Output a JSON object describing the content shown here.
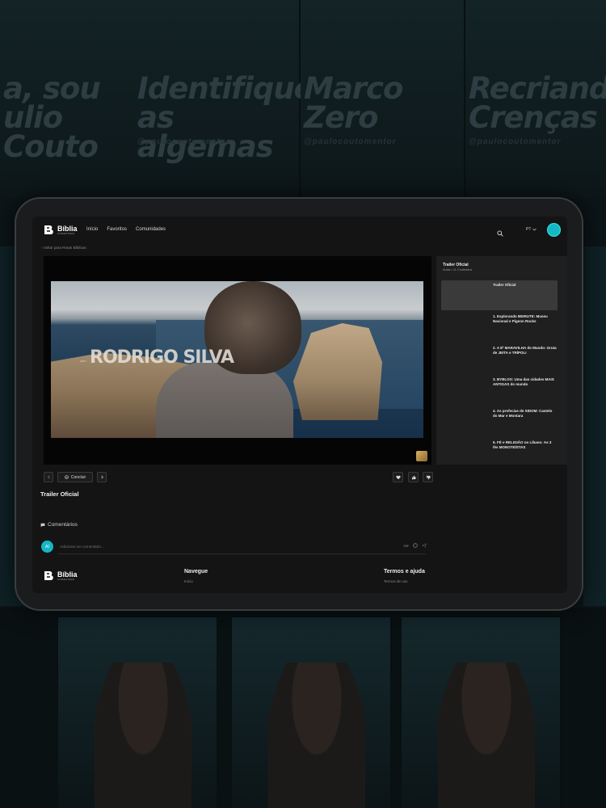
{
  "background": {
    "posters": [
      {
        "title": "a, sou\nulio Couto",
        "handle": ""
      },
      {
        "title": "Identifique\nas algemas",
        "handle": "@paulocoutomentor"
      },
      {
        "title": "Marco\nZero",
        "handle": "@paulocoutomentor"
      },
      {
        "title": "Recriando\nCrenças",
        "handle": "@paulocoutomentor"
      }
    ]
  },
  "nav": {
    "logo_title": "Bíblia",
    "logo_sub": "CONECTADA",
    "links": [
      "Início",
      "Favoritos",
      "Comunidades"
    ],
    "language": "PT"
  },
  "breadcrumb": {
    "back": "‹ Voltar para Rotas Bíblicas"
  },
  "video": {
    "overlay_pre": "com",
    "overlay_name": "RODRIGO SILVA",
    "title": "Trailer Oficial"
  },
  "controls": {
    "complete_label": "Concluir"
  },
  "comments": {
    "heading": "Comentários",
    "avatar_initials": "AI",
    "placeholder": "Adicionar um comentário...",
    "gif_label": "GIF"
  },
  "panel": {
    "title": "Trailer Oficial",
    "meta": "Aulas • 11 Conteúdos",
    "episodes": [
      {
        "label": "Trailer Oficial",
        "active": true
      },
      {
        "label": "1. Explorando BEIRUTE: Museu Nacional e Pigeon Rocks",
        "active": false
      },
      {
        "label": "2. A 8ª MARAVILHA do Mundo: Gruta de JEITA e TRÍPOLI",
        "active": false
      },
      {
        "label": "3. BYBLOS: Uma das cidades MAIS ANTIGAS do mundo",
        "active": false
      },
      {
        "label": "4. As profecias de SIDOM: Castelo do Mar e Montara",
        "active": false
      },
      {
        "label": "5. FÉ e RELIGIÃO no Líbano: As 3 fés MONOTEÍSTAS",
        "active": false
      }
    ]
  },
  "footer": {
    "logo_title": "Bíblia",
    "logo_sub": "CONECTADA",
    "nav_heading": "Navegue",
    "nav_first_link": "Início",
    "terms_heading": "Termos e ajuda",
    "terms_first_link": "Termos de uso"
  },
  "colors": {
    "accent": "#14b8c4",
    "background": "#0c1518",
    "screen": "#141414",
    "panel": "#1f1f1f"
  }
}
